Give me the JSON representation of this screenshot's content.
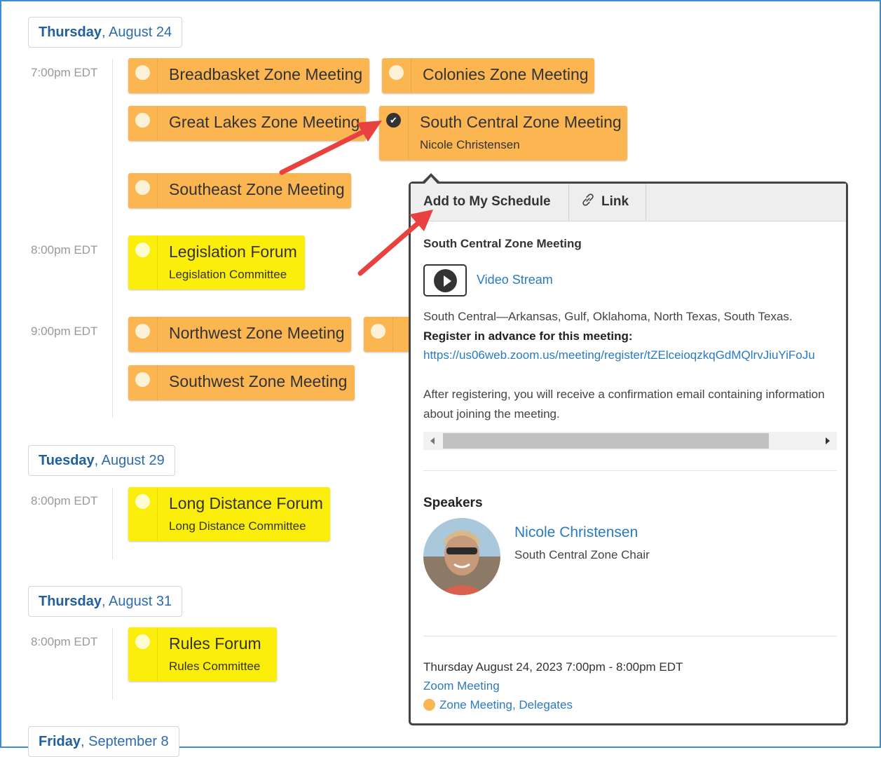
{
  "days": [
    {
      "dow": "Thursday",
      "date": ", August 24"
    },
    {
      "dow": "Tuesday",
      "date": ", August 29"
    },
    {
      "dow": "Thursday",
      "date": ", August 31"
    },
    {
      "dow": "Friday",
      "date": ", September 8"
    }
  ],
  "times": [
    "7:00pm EDT",
    "8:00pm EDT",
    "9:00pm EDT",
    "8:00pm EDT",
    "8:00pm EDT"
  ],
  "sessions": {
    "breadbasket": {
      "title": "Breadbasket Zone Meeting"
    },
    "colonies": {
      "title": "Colonies Zone Meeting"
    },
    "great_lakes": {
      "title": "Great Lakes Zone Meeting"
    },
    "south_central": {
      "title": "South Central Zone Meeting",
      "subtitle": "Nicole Christensen",
      "checked_icon": "✔"
    },
    "southeast": {
      "title": "Southeast Zone Meeting"
    },
    "legislation": {
      "title": "Legislation Forum",
      "subtitle": "Legislation Committee"
    },
    "northwest": {
      "title": "Northwest Zone Meeting"
    },
    "southwest": {
      "title": "Southwest Zone Meeting"
    },
    "long_distance": {
      "title": "Long Distance Forum",
      "subtitle": "Long Distance Committee"
    },
    "rules": {
      "title": "Rules Forum",
      "subtitle": "Rules Committee"
    }
  },
  "popup": {
    "tab_add": "Add to My Schedule",
    "tab_link": "Link",
    "title": "South Central Zone Meeting",
    "video_label": "Video Stream",
    "description": "South Central—Arkansas, Gulf, Oklahoma, North Texas, South Texas.",
    "register_label": "Register in advance for this meeting:",
    "register_url": "https://us06web.zoom.us/meeting/register/tZElceioqzkqGdMQlrvJiuYiFoJu",
    "after_text": "After registering, you will receive a confirmation email containing information about joining the meeting.",
    "speakers_heading": "Speakers",
    "speaker_name": "Nicole Christensen",
    "speaker_role": "South Central Zone Chair",
    "when": "Thursday August 24, 2023 7:00pm - 8:00pm EDT",
    "location": "Zoom Meeting",
    "tag_1": "Zone Meeting",
    "tag_sep": ", ",
    "tag_2": "Delegates"
  },
  "colors": {
    "zone_meeting": "#fbb652",
    "forum": "#fbee0a",
    "link": "#2a7ac0",
    "annotation_arrow": "#e8413f"
  },
  "icons": {
    "link_tab": "link-icon",
    "video": "play-icon",
    "checked": "check-icon"
  }
}
